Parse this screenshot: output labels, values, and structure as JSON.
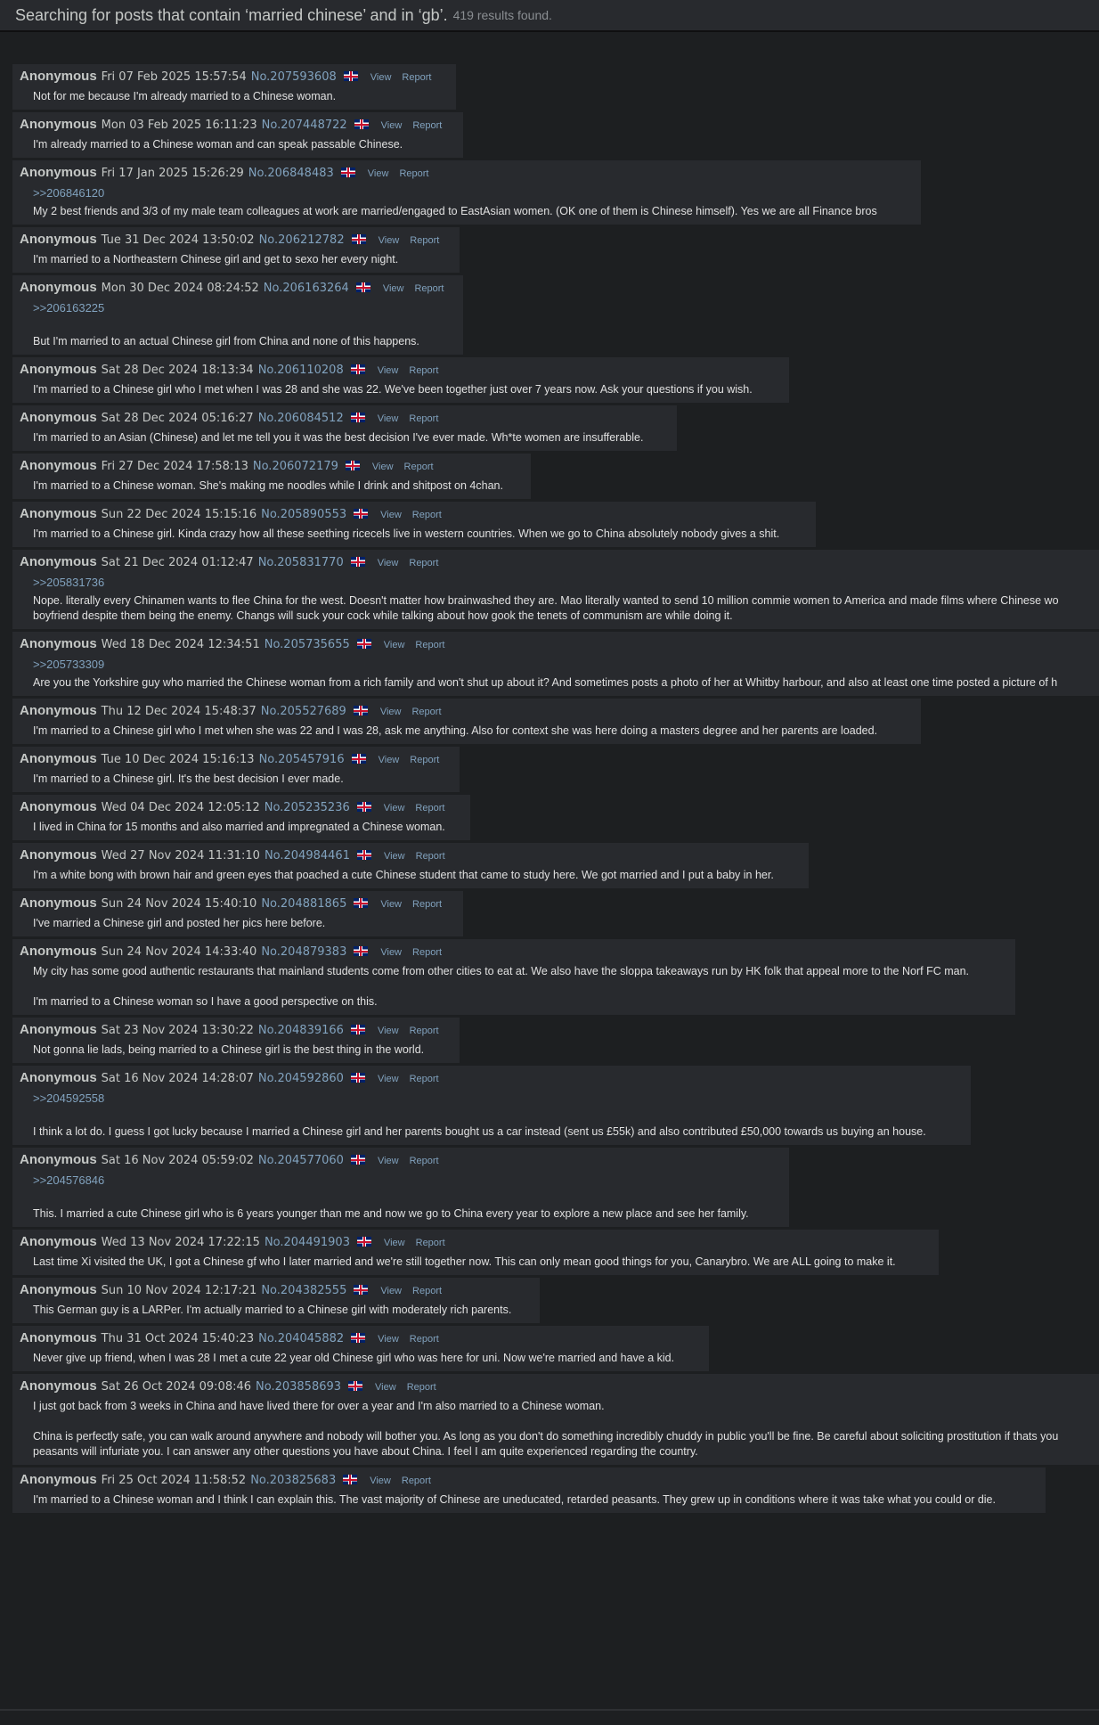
{
  "header": {
    "title": "Searching for posts that contain ‘married chinese’ and in ‘gb’.",
    "results": "419 results found."
  },
  "labels": {
    "view": "View",
    "report": "Report"
  },
  "posts": [
    {
      "name": "Anonymous",
      "date": "Fri 07 Feb 2025 15:57:54",
      "no": "No.207593608",
      "quote": "",
      "body": "Not for me because I'm already married to a Chinese woman."
    },
    {
      "name": "Anonymous",
      "date": "Mon 03 Feb 2025 16:11:23",
      "no": "No.207448722",
      "quote": "",
      "body": "I'm already married to a Chinese woman and can speak passable Chinese."
    },
    {
      "name": "Anonymous",
      "date": "Fri 17 Jan 2025 15:26:29",
      "no": "No.206848483",
      "quote": ">>206846120",
      "body": "My 2 best friends and 3/3 of my male team colleagues at work are married/engaged to EastAsian women. (OK one of them is Chinese himself). Yes we are all Finance bros"
    },
    {
      "name": "Anonymous",
      "date": "Tue 31 Dec 2024 13:50:02",
      "no": "No.206212782",
      "quote": "",
      "body": "I'm married to a Northeastern Chinese girl and get to sexo her every night."
    },
    {
      "name": "Anonymous",
      "date": "Mon 30 Dec 2024 08:24:52",
      "no": "No.206163264",
      "quote": ">>206163225",
      "body": "\nBut I'm married to an actual Chinese girl from China and none of this happens."
    },
    {
      "name": "Anonymous",
      "date": "Sat 28 Dec 2024 18:13:34",
      "no": "No.206110208",
      "quote": "",
      "body": "I'm married to a Chinese girl who I met when I was 28 and she was 22. We've been together just over 7 years now. Ask your questions if you wish."
    },
    {
      "name": "Anonymous",
      "date": "Sat 28 Dec 2024 05:16:27",
      "no": "No.206084512",
      "quote": "",
      "body": "I'm married to an Asian (Chinese) and let me tell you it was the best decision I've ever made. Wh*te women are insufferable."
    },
    {
      "name": "Anonymous",
      "date": "Fri 27 Dec 2024 17:58:13",
      "no": "No.206072179",
      "quote": "",
      "body": "I'm married to a Chinese woman. She's making me noodles while I drink and shitpost on 4chan."
    },
    {
      "name": "Anonymous",
      "date": "Sun 22 Dec 2024 15:15:16",
      "no": "No.205890553",
      "quote": "",
      "body": "I'm married to a Chinese girl. Kinda crazy how all these seething ricecels live in western countries. When we go to China absolutely nobody gives a shit."
    },
    {
      "name": "Anonymous",
      "date": "Sat 21 Dec 2024 01:12:47",
      "no": "No.205831770",
      "quote": ">>205831736",
      "body": "Nope. literally every Chinamen wants to flee China for the west. Doesn't matter how brainwashed they are. Mao literally wanted to send 10 million commie women to America and made films where Chinese wo\nboyfriend despite them being the enemy. Changs will suck your cock while talking about how gook the tenets of communism are while doing it."
    },
    {
      "name": "Anonymous",
      "date": "Wed 18 Dec 2024 12:34:51",
      "no": "No.205735655",
      "quote": ">>205733309",
      "body": "Are you the Yorkshire guy who married the Chinese woman from a rich family and won't shut up about it? And sometimes posts a photo of her at Whitby harbour, and also at least one time posted a picture of h"
    },
    {
      "name": "Anonymous",
      "date": "Thu 12 Dec 2024 15:48:37",
      "no": "No.205527689",
      "quote": "",
      "body": "I'm married to a Chinese girl who I met when she was 22 and I was 28, ask me anything. Also for context she was here doing a masters degree and her parents are loaded."
    },
    {
      "name": "Anonymous",
      "date": "Tue 10 Dec 2024 15:16:13",
      "no": "No.205457916",
      "quote": "",
      "body": "I'm married to a Chinese girl. It's the best decision I ever made."
    },
    {
      "name": "Anonymous",
      "date": "Wed 04 Dec 2024 12:05:12",
      "no": "No.205235236",
      "quote": "",
      "body": "I lived in China for 15 months and also married and impregnated a Chinese woman."
    },
    {
      "name": "Anonymous",
      "date": "Wed 27 Nov 2024 11:31:10",
      "no": "No.204984461",
      "quote": "",
      "body": "I'm a white bong with brown hair and green eyes that poached a cute Chinese student that came to study here. We got married and I put a baby in her."
    },
    {
      "name": "Anonymous",
      "date": "Sun 24 Nov 2024 15:40:10",
      "no": "No.204881865",
      "quote": "",
      "body": "I've married a Chinese girl and posted her pics here before."
    },
    {
      "name": "Anonymous",
      "date": "Sun 24 Nov 2024 14:33:40",
      "no": "No.204879383",
      "quote": "",
      "body": "My city has some good authentic restaurants that mainland students come from other cities to eat at. We also have the sloppa takeaways run by HK folk that appeal more to the Norf FC man.\n\nI'm married to a Chinese woman so I have a good perspective on this."
    },
    {
      "name": "Anonymous",
      "date": "Sat 23 Nov 2024 13:30:22",
      "no": "No.204839166",
      "quote": "",
      "body": "Not gonna lie lads, being married to a Chinese girl is the best thing in the world."
    },
    {
      "name": "Anonymous",
      "date": "Sat 16 Nov 2024 14:28:07",
      "no": "No.204592860",
      "quote": ">>204592558",
      "body": "\nI think a lot do. I guess I got lucky because I married a Chinese girl and her parents bought us a car instead (sent us £55k) and also contributed £50,000 towards us buying an house."
    },
    {
      "name": "Anonymous",
      "date": "Sat 16 Nov 2024 05:59:02",
      "no": "No.204577060",
      "quote": ">>204576846",
      "body": "\nThis. I married a cute Chinese girl who is 6 years younger than me and now we go to China every year to explore a new place and see her family."
    },
    {
      "name": "Anonymous",
      "date": "Wed 13 Nov 2024 17:22:15",
      "no": "No.204491903",
      "quote": "",
      "body": "Last time Xi visited the UK, I got a Chinese gf who I later married and we're still together now. This can only mean good things for you, Canarybro. We are ALL going to make it."
    },
    {
      "name": "Anonymous",
      "date": "Sun 10 Nov 2024 12:17:21",
      "no": "No.204382555",
      "quote": "",
      "body": "This German guy is a LARPer. I'm actually married to a Chinese girl with moderately rich parents."
    },
    {
      "name": "Anonymous",
      "date": "Thu 31 Oct 2024 15:40:23",
      "no": "No.204045882",
      "quote": "",
      "body": "Never give up friend, when I was 28 I met a cute 22 year old Chinese girl who was here for uni. Now we're married and have a kid."
    },
    {
      "name": "Anonymous",
      "date": "Sat 26 Oct 2024 09:08:46",
      "no": "No.203858693",
      "quote": "",
      "body": "I just got back from 3 weeks in China and have lived there for over a year and I'm also married to a Chinese woman.\n\nChina is perfectly safe, you can walk around anywhere and nobody will bother you. As long as you don't do something incredibly chuddy in public you'll be fine. Be careful about soliciting prostitution if thats you\npeasants will infuriate you. I can answer any other questions you have about China. I feel I am quite experienced regarding the country."
    },
    {
      "name": "Anonymous",
      "date": "Fri 25 Oct 2024 11:58:52",
      "no": "No.203825683",
      "quote": "",
      "body": "I'm married to a Chinese woman and I think I can explain this. The vast majority of Chinese are uneducated, retarded peasants. They grew up in conditions where it was take what you could or die."
    }
  ]
}
